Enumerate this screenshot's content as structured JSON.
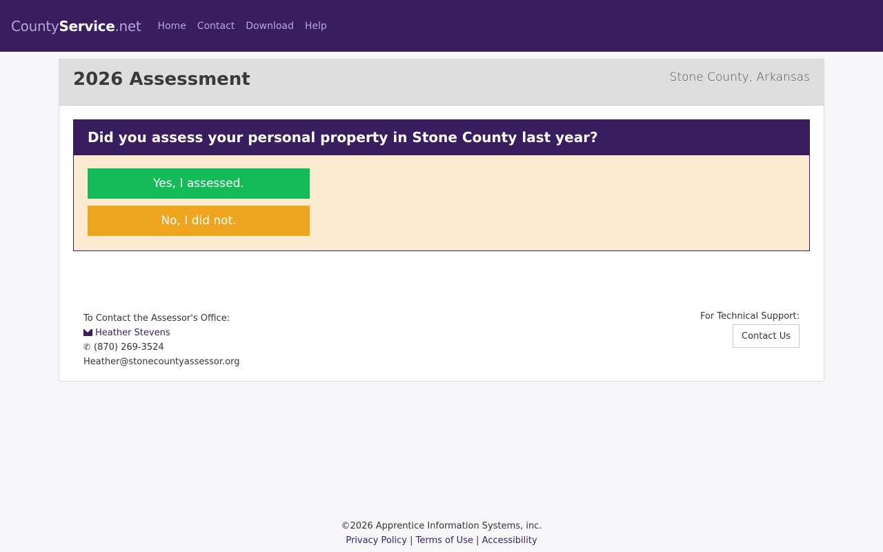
{
  "navbar": {
    "brand_part1": "County",
    "brand_part2": "Service",
    "brand_part3": ".net",
    "links": [
      "Home",
      "Contact",
      "Download",
      "Help"
    ]
  },
  "header": {
    "title": "2026 Assessment",
    "county": "Stone County, Arkansas"
  },
  "question": {
    "text": "Did you assess your personal property in Stone County last year?",
    "yes_label": "Yes, I assessed.",
    "no_label": "No, I did not."
  },
  "contact": {
    "heading": "To Contact the Assessor's Office:",
    "name": "Heather Stevens",
    "phone": "(870) 269-3524",
    "email": "Heather@stonecountyassessor.org",
    "support_heading": "For Technical Support:",
    "support_button": "Contact Us"
  },
  "footer": {
    "copyright": "©2026 Apprentice Information Systems, inc.",
    "privacy": "Privacy Policy",
    "terms": "Terms of Use",
    "accessibility": "Accessibility",
    "separator": "|"
  },
  "colors": {
    "brand": "#381e5f",
    "yes": "#15bb58",
    "no": "#efa51f",
    "question_bg": "#fbebd1"
  }
}
